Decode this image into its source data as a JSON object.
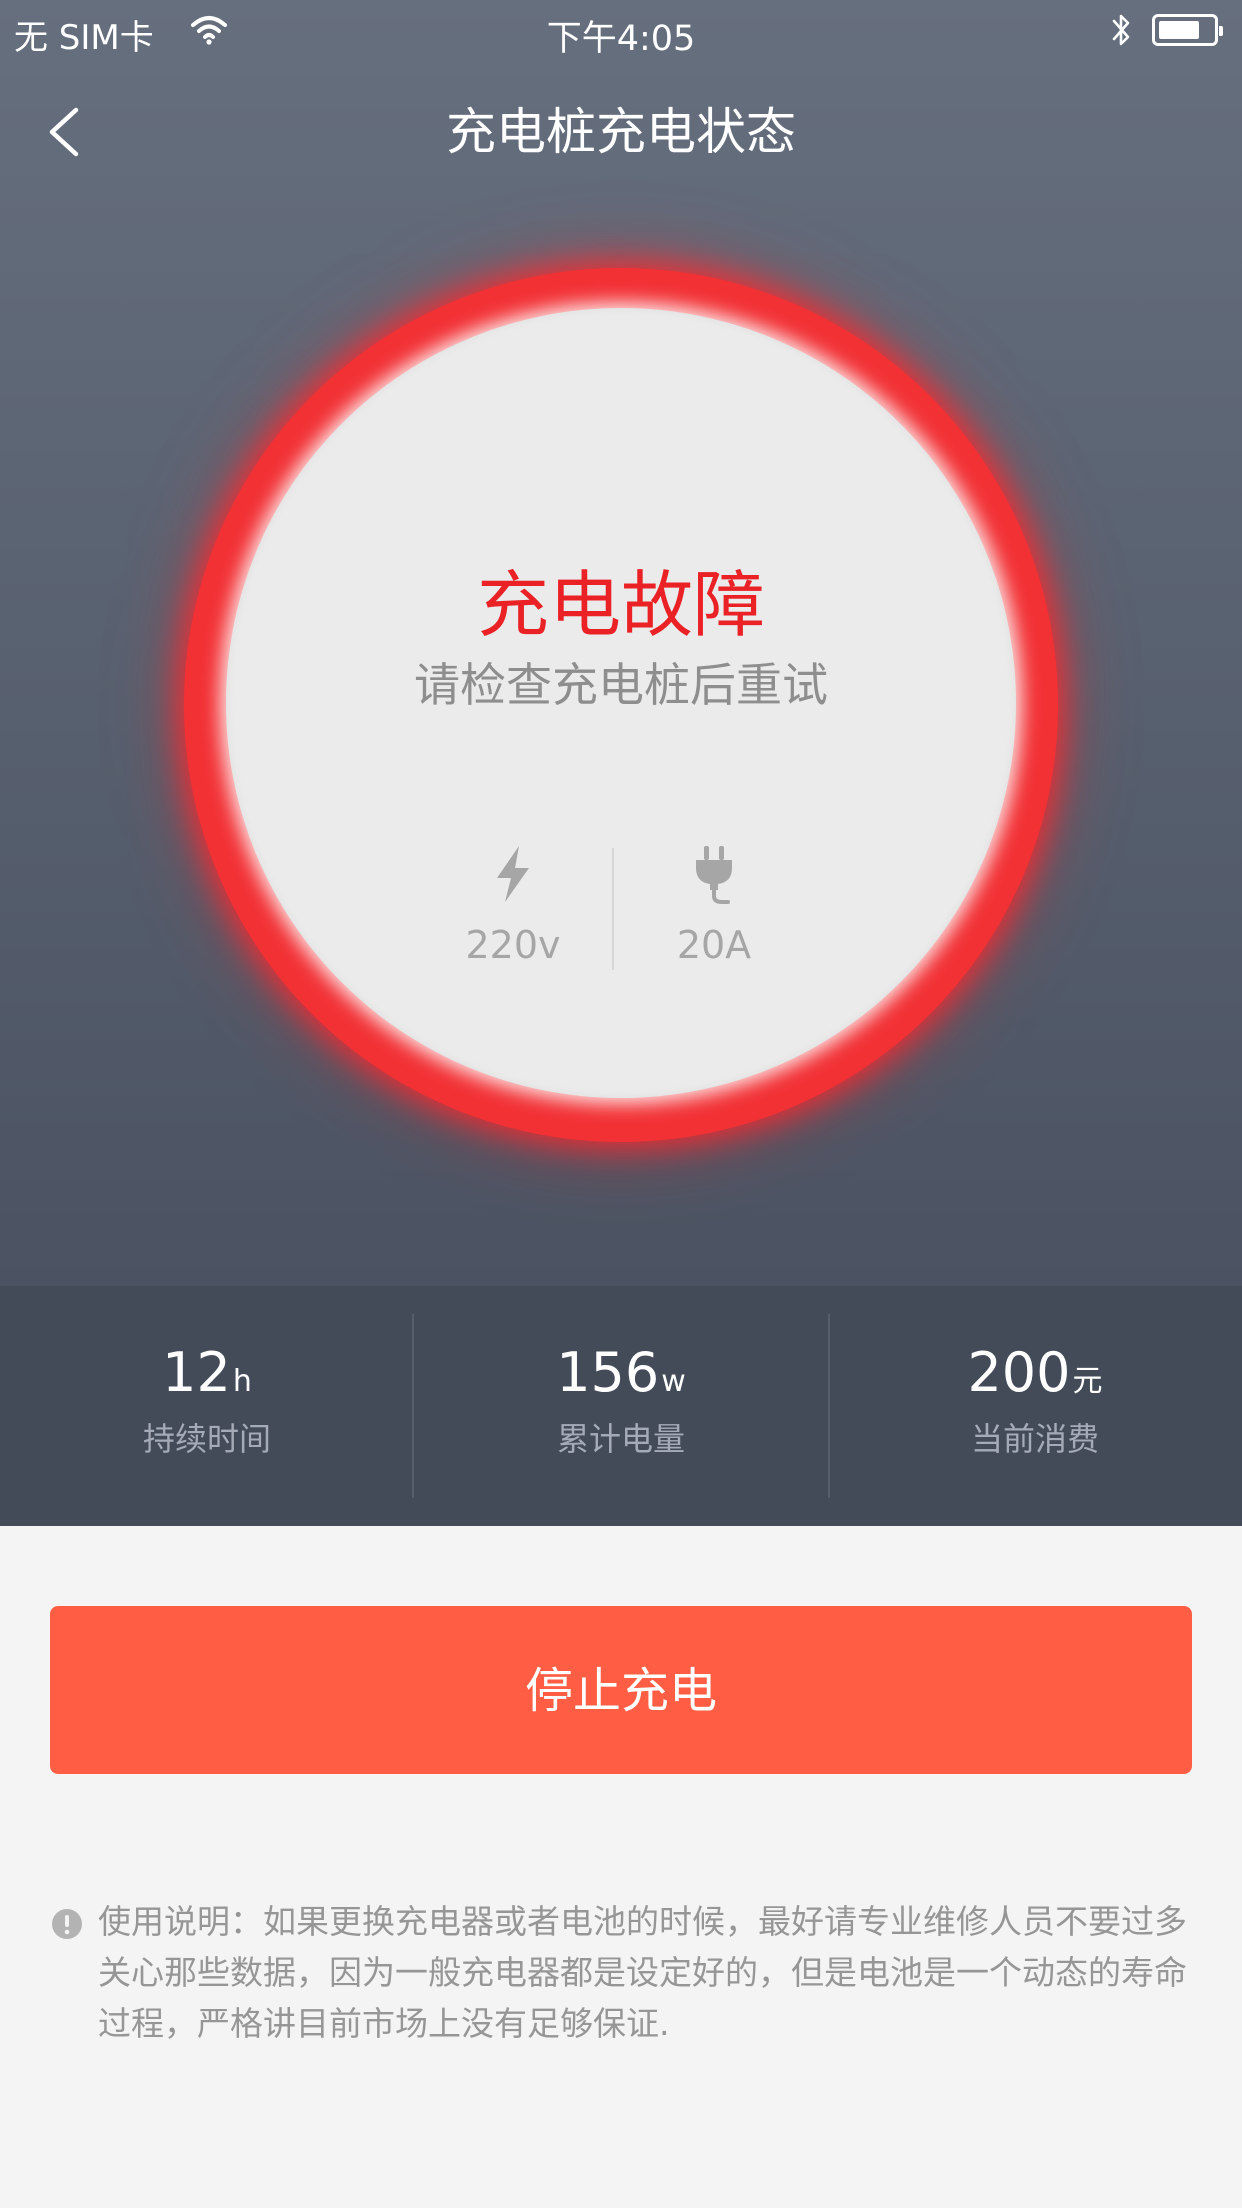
{
  "status_bar": {
    "carrier": "无 SIM卡",
    "time": "下午4:05",
    "wifi_icon": "wifi-icon",
    "bluetooth_icon": "bluetooth-icon",
    "battery_level": 0.75
  },
  "nav": {
    "back_icon": "chevron-left-icon",
    "title": "充电桩充电状态"
  },
  "status_ring": {
    "title": "充电故障",
    "subtitle": "请检查充电桩后重试",
    "ring_color": "#f23135",
    "voltage": {
      "icon": "lightning-icon",
      "value": "220v"
    },
    "current": {
      "icon": "plug-icon",
      "value": "20A"
    }
  },
  "stats": [
    {
      "value": "12",
      "unit": "h",
      "label": "持续时间"
    },
    {
      "value": "156",
      "unit": "w",
      "label": "累计电量"
    },
    {
      "value": "200",
      "unit": "元",
      "label": "当前消费"
    }
  ],
  "stop_button": {
    "label": "停止充电",
    "color": "#ff5e45"
  },
  "note": {
    "icon": "exclamation-circle-icon",
    "text": "使用说明：如果更换充电器或者电池的时候，最好请专业维修人员不要过多关心那些数据，因为一般充电器都是设定好的，但是电池是一个动态的寿命过程，严格讲目前市场上没有足够保证."
  }
}
